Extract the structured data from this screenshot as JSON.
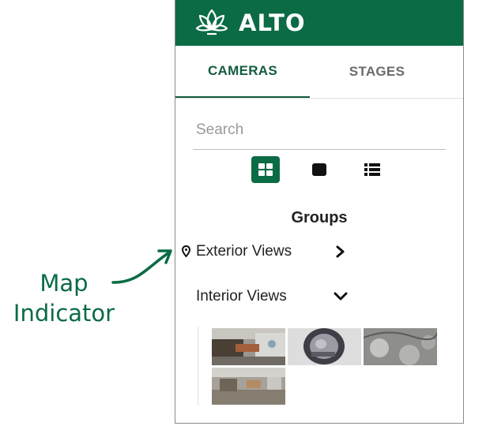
{
  "header": {
    "app_name": "ALTO",
    "logo_icon": "lotus-icon",
    "bg_color": "#0b6b45"
  },
  "tabs": [
    {
      "label": "CAMERAS",
      "active": true
    },
    {
      "label": "STAGES",
      "active": false
    }
  ],
  "search": {
    "placeholder": "Search",
    "value": ""
  },
  "view_modes": [
    {
      "icon": "grid-view-icon",
      "active": true
    },
    {
      "icon": "single-view-icon",
      "active": false
    },
    {
      "icon": "list-view-icon",
      "active": false
    }
  ],
  "groups": {
    "title": "Groups",
    "items": [
      {
        "label": "Exterior Views",
        "has_map": true,
        "expanded": false,
        "chevron": "chevron-right-icon"
      },
      {
        "label": "Interior Views",
        "has_map": false,
        "expanded": true,
        "chevron": "chevron-down-icon"
      }
    ]
  },
  "camera_thumbnails": [
    {
      "name": "camera-thumbnail-1",
      "scene": "interior room"
    },
    {
      "name": "camera-thumbnail-2",
      "scene": "fisheye view"
    },
    {
      "name": "camera-thumbnail-3",
      "scene": "interior detail"
    },
    {
      "name": "camera-thumbnail-4",
      "scene": "interior room"
    }
  ],
  "annotation": {
    "line1": "Map",
    "line2": "Indicator",
    "color": "#0b6b45"
  }
}
